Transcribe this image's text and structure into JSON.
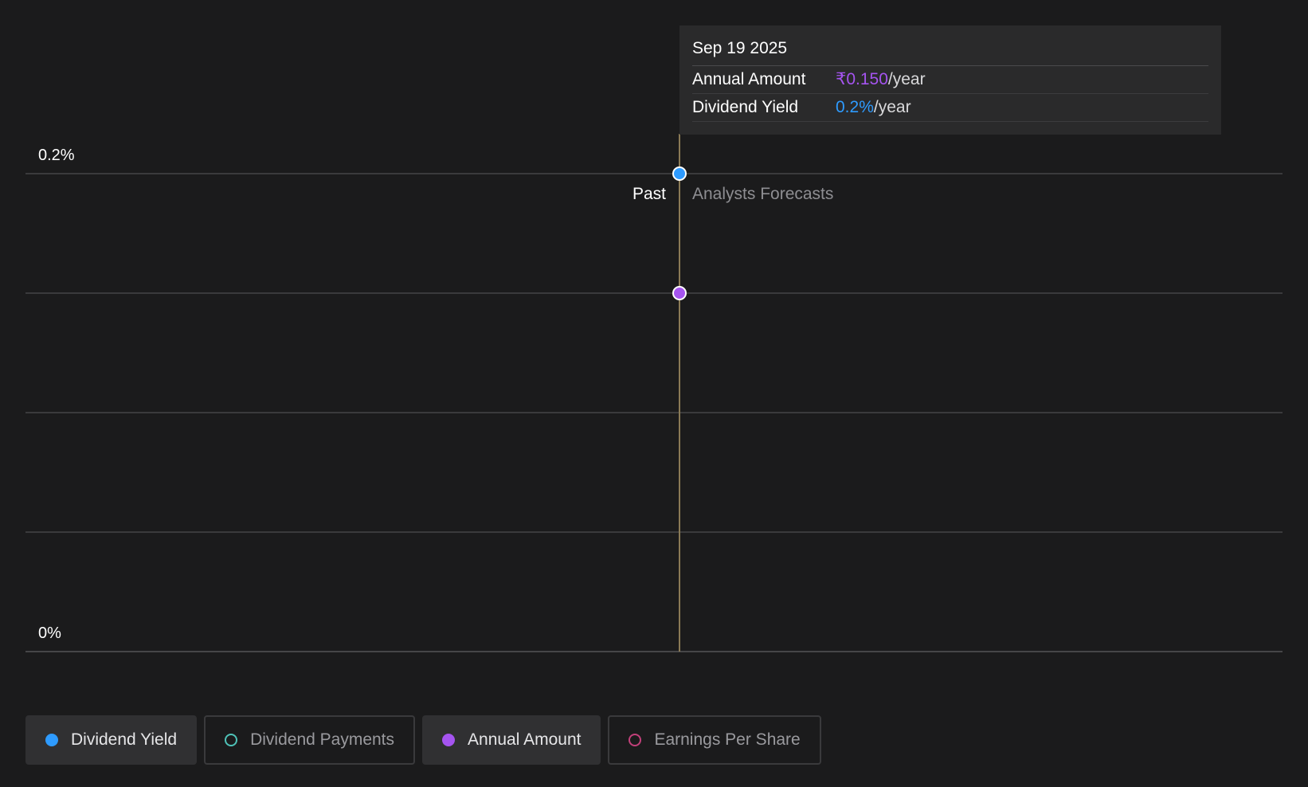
{
  "chart_data": {
    "type": "line",
    "y_ticks": [
      "0.2%",
      "0%"
    ],
    "ylim": [
      0,
      0.2
    ],
    "grid": true,
    "marker": {
      "date": "Sep 19 2025",
      "past_label": "Past",
      "forecast_label": "Analysts Forecasts"
    },
    "series": [
      {
        "name": "Dividend Yield",
        "color": "#2e9bff",
        "points": [
          {
            "x": "Sep 19 2025",
            "y": 0.2
          }
        ]
      },
      {
        "name": "Annual Amount",
        "color": "#a554f0",
        "points": [
          {
            "x": "Sep 19 2025",
            "y": 0.15
          }
        ]
      }
    ],
    "tooltip": {
      "title": "Sep 19 2025",
      "rows": [
        {
          "label": "Annual Amount",
          "value": "₹0.150",
          "unit": "/year",
          "color": "#a554f0"
        },
        {
          "label": "Dividend Yield",
          "value": "0.2%",
          "unit": "/year",
          "color": "#2e9bff"
        }
      ]
    },
    "legend": [
      {
        "label": "Dividend Yield",
        "color": "#2e9bff",
        "active": true
      },
      {
        "label": "Dividend Payments",
        "color": "#4fc3b8",
        "active": false
      },
      {
        "label": "Annual Amount",
        "color": "#a554f0",
        "active": true
      },
      {
        "label": "Earnings Per Share",
        "color": "#c2407a",
        "active": false
      }
    ]
  }
}
